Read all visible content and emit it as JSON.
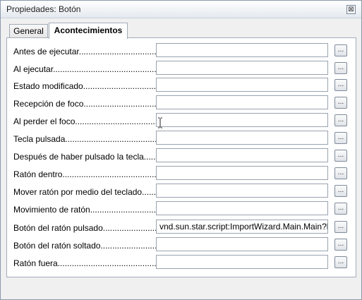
{
  "window": {
    "title": "Propiedades: Botón",
    "close_glyph": "⊠"
  },
  "tabs": [
    {
      "label": "General",
      "active": false
    },
    {
      "label": "Acontecimientos",
      "active": true
    }
  ],
  "events": [
    {
      "label": "Antes de ejecutar......................................................",
      "value": ""
    },
    {
      "label": "Al ejecutar..............................................................",
      "value": ""
    },
    {
      "label": "Estado modificado................................................",
      "value": ""
    },
    {
      "label": "Recepción de foco..................................................",
      "value": ""
    },
    {
      "label": "Al perder el foco......................................................",
      "value": ""
    },
    {
      "label": "Tecla pulsada..............................................................",
      "value": ""
    },
    {
      "label": "Después de haber pulsado la tecla.......",
      "value": ""
    },
    {
      "label": "Ratón dentro..............................................................",
      "value": ""
    },
    {
      "label": "Mover ratón por medio del teclado.......",
      "value": ""
    },
    {
      "label": "Movimiento de ratón..................................................",
      "value": ""
    },
    {
      "label": "Botón del ratón pulsado............................................",
      "value": "vnd.sun.star.script:ImportWizard.Main.Main?la"
    },
    {
      "label": "Botón del ratón soltado............................................",
      "value": ""
    },
    {
      "label": "Ratón fuera..................................................................",
      "value": ""
    }
  ],
  "ellipsis_label": "..."
}
